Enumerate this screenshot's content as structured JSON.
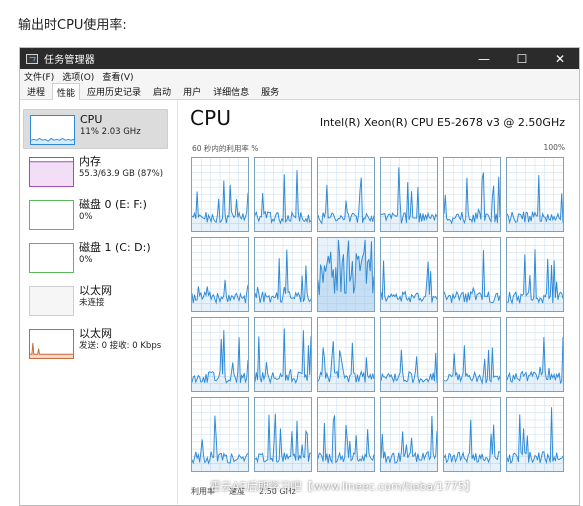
{
  "caption": "输出时CPU使用率:",
  "window": {
    "title": "任务管理器",
    "buttons": {
      "minimize": "—",
      "maximize": "☐",
      "close": "✕"
    }
  },
  "menu": [
    "文件(F)",
    "选项(O)",
    "查看(V)"
  ],
  "tabs": [
    "进程",
    "性能",
    "应用历史记录",
    "启动",
    "用户",
    "详细信息",
    "服务"
  ],
  "sidebar": [
    {
      "id": "cpu",
      "title": "CPU",
      "subtitle": "11% 2.03 GHz",
      "color": "#2f8ad6",
      "icon": "cpu-thumb-icon"
    },
    {
      "id": "memory",
      "title": "内存",
      "subtitle": "55.3/63.9 GB (87%)",
      "color": "#a24bbd",
      "icon": "memory-thumb-icon"
    },
    {
      "id": "disk0",
      "title": "磁盘 0 (E: F:)",
      "subtitle": "0%",
      "color": "#5cb85c",
      "icon": "disk-thumb-icon"
    },
    {
      "id": "disk1",
      "title": "磁盘 1 (C: D:)",
      "subtitle": "0%",
      "color": "#5cb85c",
      "icon": "disk-thumb-icon"
    },
    {
      "id": "eth0",
      "title": "以太网",
      "subtitle": "未连接",
      "color": "#9a9a9a",
      "icon": "ethernet-thumb-icon"
    },
    {
      "id": "eth1",
      "title": "以太网",
      "subtitle": "发送: 0 接收: 0 Kbps",
      "color": "#c46a3b",
      "icon": "ethernet-thumb-icon"
    }
  ],
  "main": {
    "title": "CPU",
    "model": "Intel(R) Xeon(R) CPU E5-2678 v3 @ 2.50GHz",
    "util_left": "60 秒内的利用率 %",
    "util_right": "100%",
    "bottom": {
      "util_label": "利用率",
      "speed_label": "速度",
      "speed_value": "2.50 GHz"
    }
  },
  "watermark": "霍云AE后期学习吧【www.lineec.com/tieba/1775】",
  "colors": {
    "accent": "#2f8ad6",
    "grid": "#cfe1f0",
    "titlebar": "#2b2b2b"
  }
}
